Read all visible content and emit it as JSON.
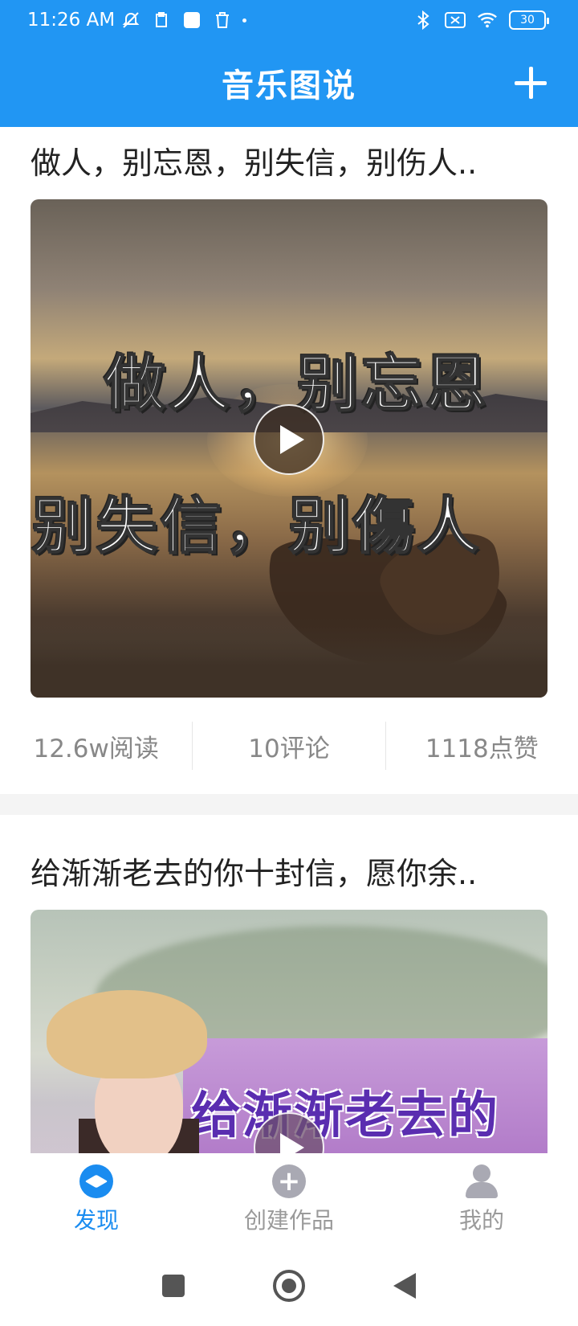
{
  "status_bar": {
    "time": "11:26 AM",
    "battery": "30",
    "icons": [
      "mute-vibrate-icon",
      "clipboard-icon",
      "app-icon",
      "trash-icon",
      "dot-icon",
      "bluetooth-icon",
      "sim-off-icon",
      "wifi-icon",
      "battery-icon"
    ]
  },
  "app_bar": {
    "title": "音乐图说",
    "action_icon": "plus-icon"
  },
  "feed": [
    {
      "title": "做人，别忘恩，别失信，别伤人..",
      "image_text_line1": "做人，别忘恩",
      "image_text_line2": "别失信，别傷人",
      "reads": "12.6w阅读",
      "comments": "10评论",
      "likes": "1118点赞"
    },
    {
      "title": "给渐渐老去的你十封信，愿你余..",
      "image_text_line1": "给渐渐老去的"
    }
  ],
  "bottom_nav": {
    "items": [
      {
        "label": "发现",
        "icon": "compass-icon",
        "active": true
      },
      {
        "label": "创建作品",
        "icon": "add-circle-icon",
        "active": false
      },
      {
        "label": "我的",
        "icon": "person-icon",
        "active": false
      }
    ]
  },
  "colors": {
    "primary": "#2196f3",
    "active_nav": "#1a8cf0",
    "inactive_nav": "#9a9a9a"
  }
}
